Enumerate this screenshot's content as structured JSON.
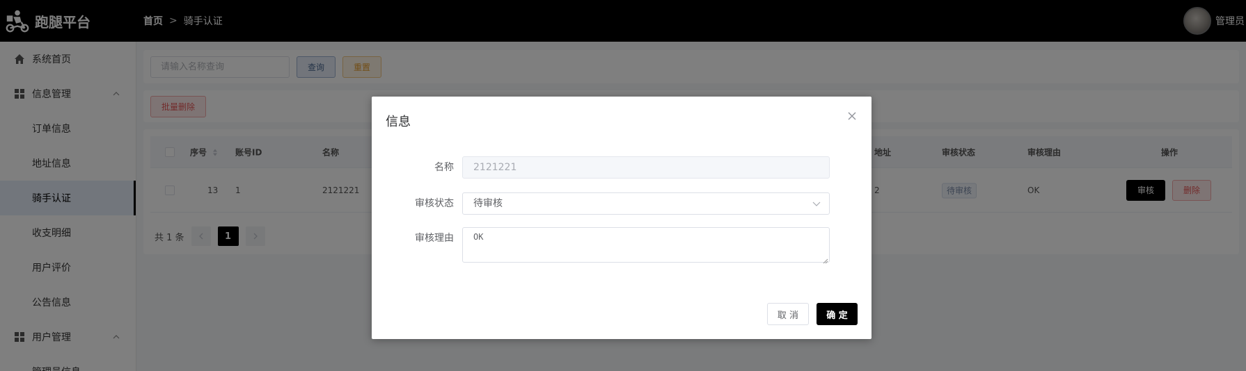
{
  "header": {
    "logo_text": "跑腿平台",
    "breadcrumb_home": "首页",
    "breadcrumb_current": "骑手认证",
    "user_name": "管理员"
  },
  "sidebar": {
    "items": [
      {
        "label": "系统首页",
        "icon": "home-icon"
      },
      {
        "label": "信息管理",
        "icon": "grid-icon",
        "expanded": true
      },
      {
        "label": "订单信息"
      },
      {
        "label": "地址信息"
      },
      {
        "label": "骑手认证",
        "active": true
      },
      {
        "label": "收支明细"
      },
      {
        "label": "用户评价"
      },
      {
        "label": "公告信息"
      },
      {
        "label": "用户管理",
        "icon": "grid-icon",
        "expanded": true
      },
      {
        "label": "管理员信息"
      }
    ]
  },
  "toolbar": {
    "search_placeholder": "请输入名称查询",
    "query_label": "查询",
    "reset_label": "重置",
    "batch_delete_label": "批量删除"
  },
  "table": {
    "columns": [
      "序号",
      "账号ID",
      "名称",
      "地址",
      "审核状态",
      "审核理由",
      "操作"
    ],
    "rows": [
      {
        "index": "13",
        "account_id": "1",
        "name": "2121221",
        "address_fragment": "2",
        "status": "待审核",
        "reason": "OK",
        "audit_label": "审核",
        "delete_label": "删除"
      }
    ]
  },
  "pagination": {
    "total_text": "共 1 条",
    "current_page": "1"
  },
  "dialog": {
    "title": "信息",
    "fields": {
      "name_label": "名称",
      "name_value": "2121221",
      "status_label": "审核状态",
      "status_value": "待审核",
      "reason_label": "审核理由",
      "reason_value": "OK"
    },
    "cancel_label": "取 消",
    "ok_label": "确 定"
  },
  "colors": {
    "header_bg": "#000000",
    "accent": "#000000",
    "danger": "#e45656",
    "warning": "#e29a2a",
    "active_menu_bg": "#e5ecf8"
  }
}
